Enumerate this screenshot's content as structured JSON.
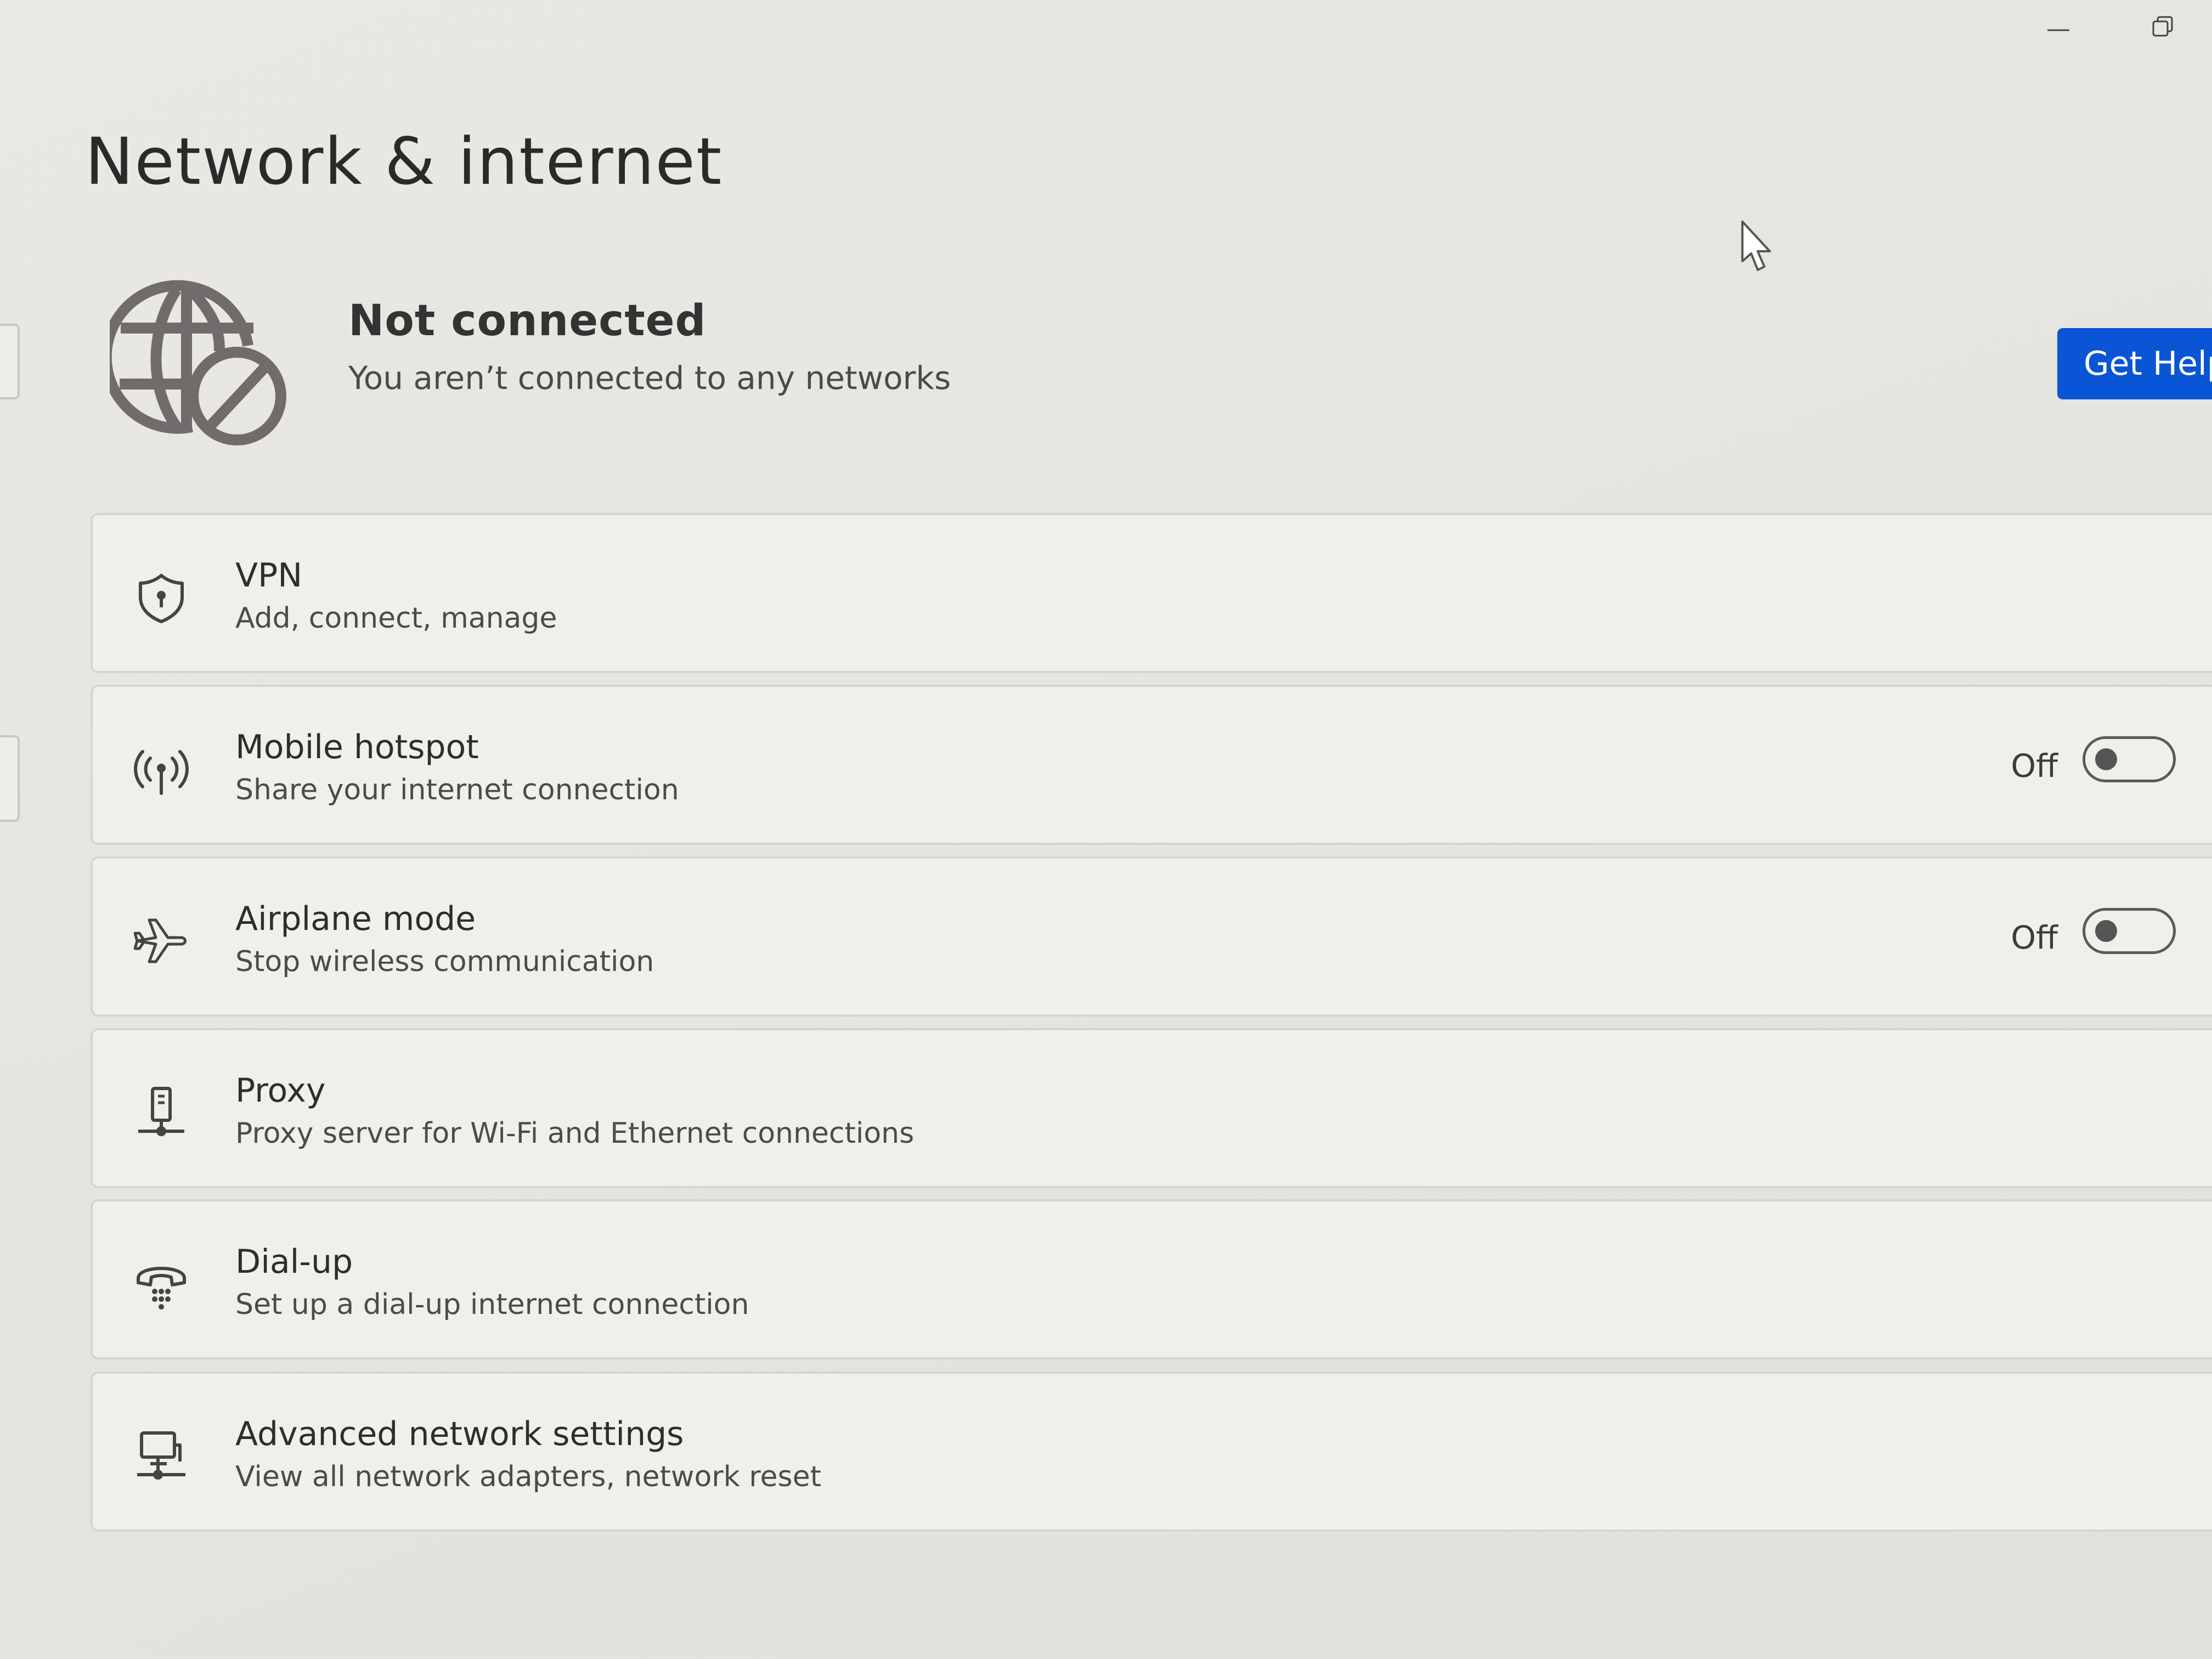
{
  "page": {
    "title": "Network & internet"
  },
  "status": {
    "title": "Not connected",
    "subtitle": "You aren’t connected to any networks",
    "icon": "globe-not-connected-icon"
  },
  "help_button": {
    "label": "Get Help"
  },
  "cards": [
    {
      "id": "vpn",
      "title": "VPN",
      "subtitle": "Add, connect, manage",
      "icon": "shield-icon"
    },
    {
      "id": "mobile-hotspot",
      "title": "Mobile hotspot",
      "subtitle": "Share your internet connection",
      "icon": "hotspot-icon",
      "toggle": {
        "state_label": "Off",
        "on": false
      }
    },
    {
      "id": "airplane-mode",
      "title": "Airplane mode",
      "subtitle": "Stop wireless communication",
      "icon": "airplane-icon",
      "toggle": {
        "state_label": "Off",
        "on": false
      }
    },
    {
      "id": "proxy",
      "title": "Proxy",
      "subtitle": "Proxy server for Wi-Fi and Ethernet connections",
      "icon": "proxy-server-icon"
    },
    {
      "id": "dial-up",
      "title": "Dial-up",
      "subtitle": "Set up a dial-up internet connection",
      "icon": "dial-up-phone-icon"
    },
    {
      "id": "advanced",
      "title": "Advanced network settings",
      "subtitle": "View all network adapters, network reset",
      "icon": "network-computer-icon"
    }
  ],
  "colors": {
    "accent": "#0a55d6",
    "background": "#e7e6e1",
    "card": "#f0efea"
  }
}
